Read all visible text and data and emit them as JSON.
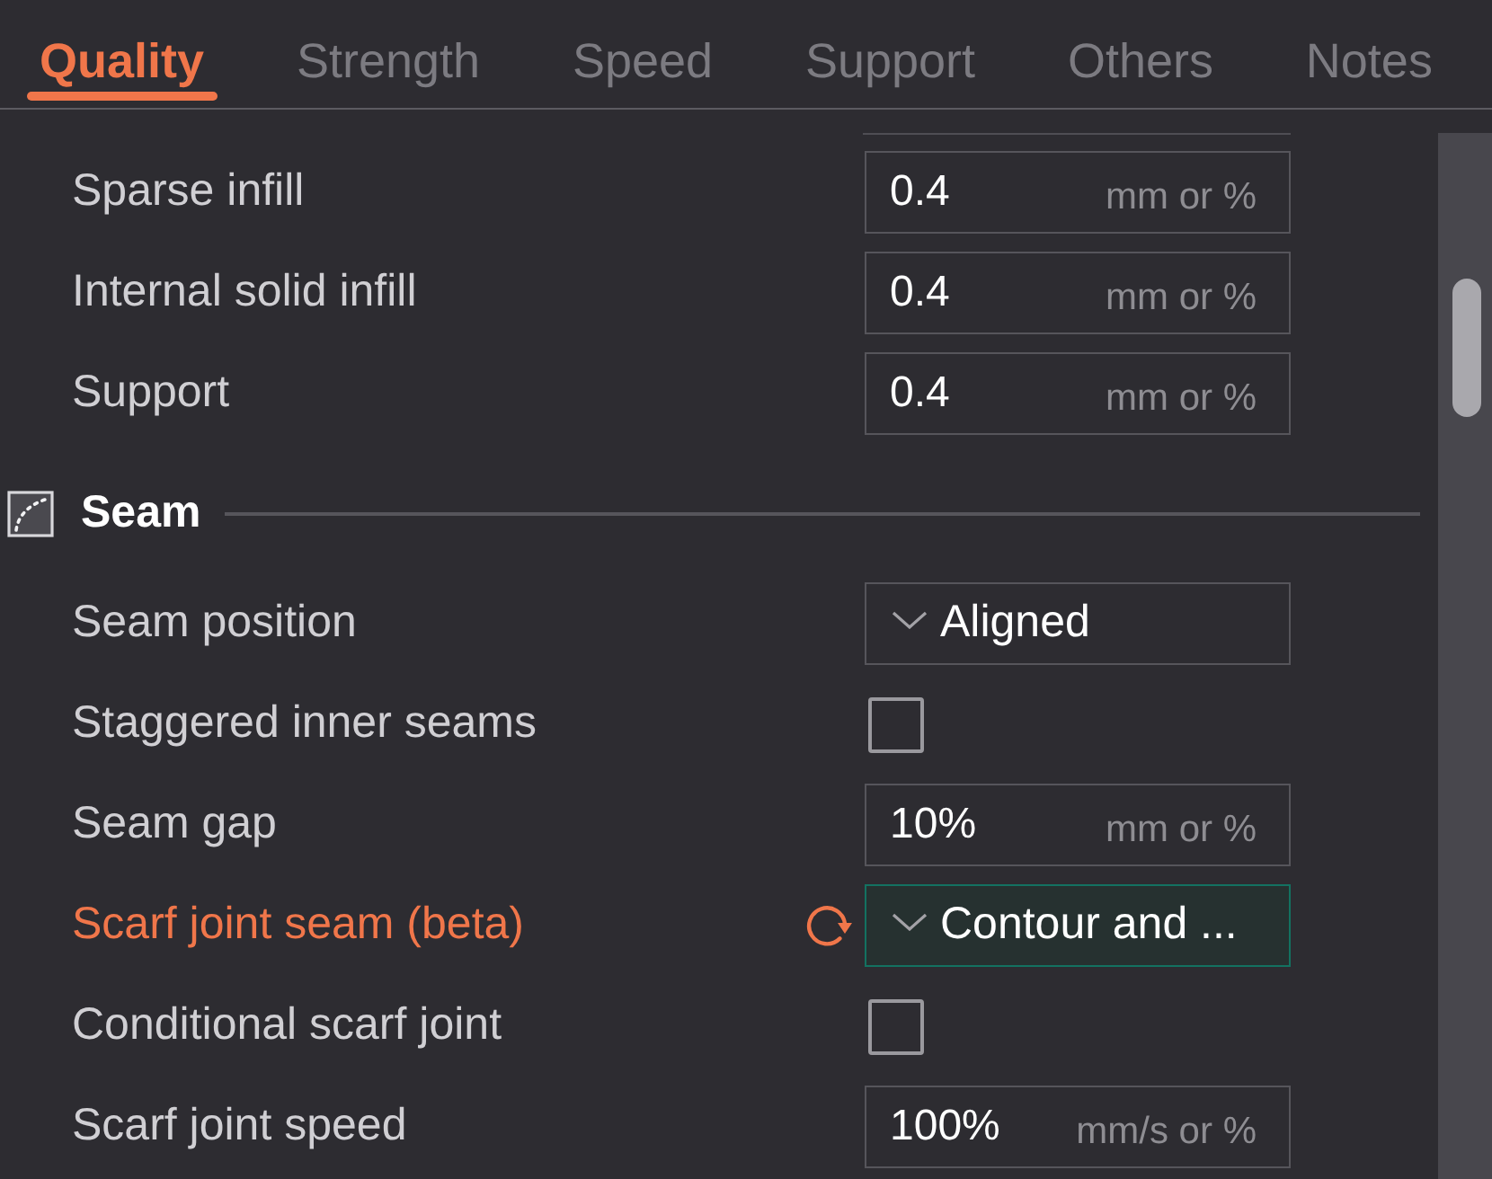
{
  "tabs": [
    {
      "label": "Quality",
      "selected": true
    },
    {
      "label": "Strength",
      "selected": false
    },
    {
      "label": "Speed",
      "selected": false
    },
    {
      "label": "Support",
      "selected": false
    },
    {
      "label": "Others",
      "selected": false
    },
    {
      "label": "Notes",
      "selected": false
    }
  ],
  "groups": [
    {
      "rows": [
        {
          "kind": "number",
          "label": "Sparse infill",
          "value": "0.4",
          "unit": "mm or %",
          "modified": false,
          "focused": false
        },
        {
          "kind": "number",
          "label": "Internal solid infill",
          "value": "0.4",
          "unit": "mm or %",
          "modified": false,
          "focused": false
        },
        {
          "kind": "number",
          "label": "Support",
          "value": "0.4",
          "unit": "mm or %",
          "modified": false,
          "focused": false
        }
      ]
    },
    {
      "title": "Seam",
      "rows": [
        {
          "kind": "dropdown",
          "label": "Seam position",
          "value": "Aligned",
          "modified": false,
          "focused": false
        },
        {
          "kind": "checkbox",
          "label": "Staggered inner seams",
          "checked": false,
          "modified": false,
          "focused": false
        },
        {
          "kind": "number",
          "label": "Seam gap",
          "value": "10%",
          "unit": "mm or %",
          "modified": false,
          "focused": false
        },
        {
          "kind": "dropdown",
          "label": "Scarf joint seam (beta)",
          "value": "Contour and ...",
          "modified": true,
          "focused": true
        },
        {
          "kind": "checkbox",
          "label": "Conditional scarf joint",
          "checked": false,
          "modified": false,
          "focused": false
        },
        {
          "kind": "number",
          "label": "Scarf joint speed",
          "value": "100%",
          "unit": "mm/s or %",
          "modified": false,
          "focused": false
        }
      ]
    }
  ]
}
